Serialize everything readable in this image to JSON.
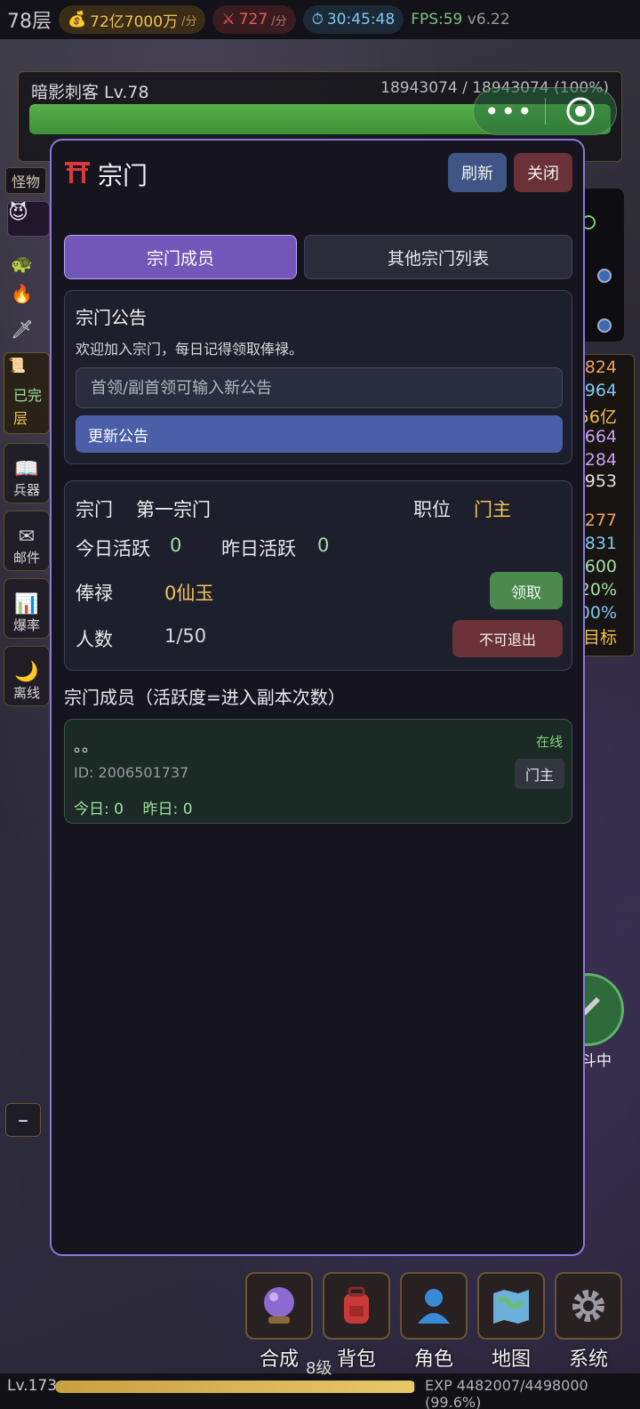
{
  "topbar": {
    "floor": "78层",
    "gold": "72亿7000万",
    "gold_unit": "/分",
    "kills": "727",
    "kills_unit": "/分",
    "timer": "30:45:48",
    "fps": "FPS:59",
    "version": "v6.22"
  },
  "boss": {
    "name": "暗影刺客 Lv.78",
    "hp": "18943074 / 18943074 (100%)",
    "hp_fraction": 1.0
  },
  "side": {
    "monster_tag": "怪物",
    "weapon": "兵器",
    "mail": "邮件",
    "drop": "爆率",
    "offline": "离线"
  },
  "right_stats": [
    "824",
    "964",
    "56亿",
    "664",
    "284",
    "953",
    "277",
    "831",
    "600",
    "20%",
    "00%",
    "目标"
  ],
  "modal": {
    "title": "宗门",
    "refresh": "刷新",
    "close": "关闭",
    "tabs": [
      "宗门成员",
      "其他宗门列表"
    ],
    "notice": {
      "title": "宗门公告",
      "text": "欢迎加入宗门，每日记得领取俸禄。",
      "placeholder": "首领/副首领可输入新公告",
      "update": "更新公告"
    },
    "info": {
      "sect_label": "宗门",
      "sect_name": "第一宗门",
      "role_label": "职位",
      "role_value": "门主",
      "today_label": "今日活跃",
      "today_value": "0",
      "yesterday_label": "昨日活跃",
      "yesterday_value": "0",
      "salary_label": "俸禄",
      "salary_value": "0仙玉",
      "claim": "领取",
      "count_label": "人数",
      "count_value": "1/50",
      "quit": "不可退出"
    },
    "members_title": "宗门成员（活跃度=进入副本次数）",
    "members": [
      {
        "name": "。。",
        "status": "在线",
        "id": "ID: 2006501737",
        "role": "门主",
        "activity": "今日: 0    昨日: 0"
      }
    ]
  },
  "fight_label": "斗中",
  "nav": [
    "合成",
    "背包",
    "角色",
    "地图",
    "系统"
  ],
  "footer": {
    "level": "Lv.173",
    "exp": "EXP 4482007/4498000 (99.6%)",
    "exp_fraction": 0.996,
    "level_hint": "8级"
  },
  "colors": {
    "accent": "#7256b8",
    "modal_border": "#8a78d8",
    "gold": "#f2c458",
    "green": "#9fe0a0",
    "danger": "#6a3238",
    "primary": "#3e5586"
  }
}
